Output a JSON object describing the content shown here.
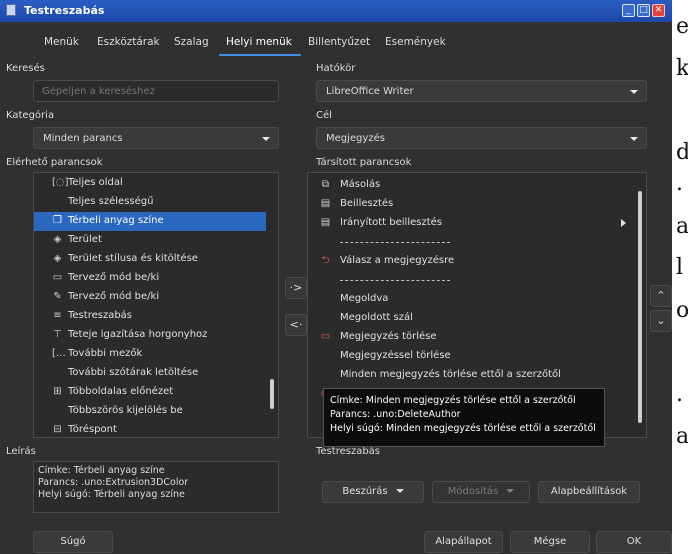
{
  "background_letters": [
    "e",
    "k",
    "d",
    ".",
    "a",
    "l",
    "o",
    ".",
    "a"
  ],
  "window": {
    "title": "Testreszabás",
    "controls": [
      "_",
      "□",
      "✕"
    ]
  },
  "tabs": [
    "Menük",
    "Eszköztárak",
    "Szalag",
    "Helyi menük",
    "Billentyűzet",
    "Események"
  ],
  "active_tab": 3,
  "search": {
    "label": "Keresés",
    "placeholder": "Gépeljen a kereséshez",
    "value": ""
  },
  "category": {
    "label": "Kategória",
    "value": "Minden parancs"
  },
  "scope": {
    "label": "Hatókör",
    "value": "LibreOffice Writer"
  },
  "target": {
    "label": "Cél",
    "value": "Megjegyzés"
  },
  "available": {
    "label": "Elérhető parancsok",
    "items": [
      {
        "icon": "[◌]",
        "icon_name": "full-page-icon",
        "label": "Teljes oldal"
      },
      {
        "icon": "",
        "icon_name": "",
        "label": "Teljes szélességű"
      },
      {
        "icon": "❒",
        "icon_name": "extrusion-color-icon",
        "label": "Térbeli anyag színe",
        "selected": true
      },
      {
        "icon": "◈",
        "icon_name": "area-icon",
        "label": "Terület"
      },
      {
        "icon": "◈",
        "icon_name": "area-style-icon",
        "label": "Terület stílusa és kitöltése"
      },
      {
        "icon": "▭",
        "icon_name": "design-mode-icon",
        "label": "Tervező mód be/ki"
      },
      {
        "icon": "✎",
        "icon_name": "design-mode-pen-icon",
        "label": "Tervező mód be/ki"
      },
      {
        "icon": "≡",
        "icon_name": "customize-icon",
        "label": "Testreszabás"
      },
      {
        "icon": "⊤",
        "icon_name": "anchor-top-icon",
        "label": "Teteje igazítása horgonyhoz"
      },
      {
        "icon": "[…",
        "icon_name": "more-fields-icon",
        "label": "További mezők"
      },
      {
        "icon": "",
        "icon_name": "",
        "label": "További szótárak letöltése"
      },
      {
        "icon": "⊞",
        "icon_name": "multipage-preview-icon",
        "label": "Többoldalas előnézet"
      },
      {
        "icon": "",
        "icon_name": "",
        "label": "Többszörös kijelölés be"
      },
      {
        "icon": "⊟",
        "icon_name": "break-icon",
        "label": "Töréspont"
      }
    ]
  },
  "assigned": {
    "label": "Társított parancsok",
    "items": [
      {
        "icon": "⧉",
        "icon_name": "copy-icon",
        "label": "Másolás"
      },
      {
        "icon": "▤",
        "icon_name": "paste-icon",
        "label": "Beillesztés"
      },
      {
        "icon": "▤",
        "icon_name": "paste-special-icon",
        "label": "Irányított beillesztés",
        "submenu": true
      },
      {
        "separator": true
      },
      {
        "icon": "⮌",
        "icon_name": "reply-comment-icon",
        "label": "Válasz a megjegyzésre",
        "accent": true
      },
      {
        "separator": true
      },
      {
        "icon": "",
        "icon_name": "",
        "label": "Megoldva"
      },
      {
        "icon": "",
        "icon_name": "",
        "label": "Megoldott szál"
      },
      {
        "icon": "▭",
        "icon_name": "delete-comment-icon",
        "label": "Megjegyzés törlése",
        "accent": true
      },
      {
        "icon": "",
        "icon_name": "",
        "label": "Megjegyzéssel törlése"
      },
      {
        "icon": "",
        "icon_name": "",
        "label": "Minden megjegyzés törlése ettől a szerzőtől"
      },
      {
        "icon": "▭",
        "icon_name": "delete-all-comments-icon",
        "label": "",
        "accent": true
      }
    ]
  },
  "side_buttons": {
    "add": "·>",
    "remove": "<·",
    "up": "⌃",
    "down": "⌄"
  },
  "description": {
    "label": "Leírás",
    "lines": [
      "Címke: Térbeli anyag színe",
      "Parancs: .uno:Extrusion3DColor",
      "Helyi súgó: Térbeli anyag színe"
    ]
  },
  "customize_label": "Testreszabás",
  "action_buttons": {
    "insert": "Beszúrás",
    "modify": "Módosítás",
    "defaults": "Alapbeállítások"
  },
  "tooltip": {
    "lines": [
      "Címke: Minden megjegyzés törlése ettől a szerzőtől",
      "Parancs: .uno:DeleteAuthor",
      "Helyi súgó: Minden megjegyzés törlése ettől a szerzőtől"
    ]
  },
  "footer": {
    "help": "Súgó",
    "reset": "Alapállapot",
    "cancel": "Mégse",
    "ok": "OK"
  },
  "colors": {
    "accent": "#2a68c0",
    "tab_underline": "#3d8ee6",
    "comment_icon": "#e05a4a"
  }
}
